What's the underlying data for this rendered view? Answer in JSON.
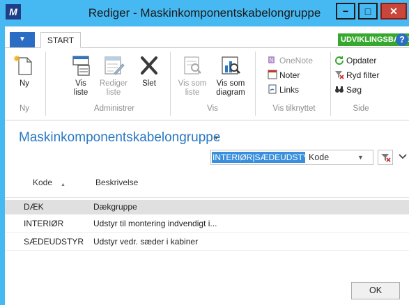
{
  "window": {
    "title": "Rediger - Maskinkomponentskabelongruppe",
    "logo": "M",
    "min": "−",
    "max": "□",
    "close": "✕"
  },
  "ribbon": {
    "menu_glyph": "▼",
    "tab_start": "START",
    "dev_badge": "UDVIKLINGSBASE",
    "help": "?",
    "ny": {
      "label": "Ny",
      "group": "Ny"
    },
    "administrer": {
      "group": "Administrer",
      "vis_liste": [
        "Vis",
        "liste"
      ],
      "rediger_liste": [
        "Rediger",
        "liste"
      ],
      "slet": "Slet"
    },
    "vis": {
      "group": "Vis",
      "vis_som_liste": [
        "Vis som",
        "liste"
      ],
      "vis_som_diagram": [
        "Vis som",
        "diagram"
      ]
    },
    "vis_tilknyttet": {
      "group": "Vis tilknyttet",
      "onenote": "OneNote",
      "noter": "Noter",
      "links": "Links"
    },
    "side": {
      "group": "Side",
      "opdater": "Opdater",
      "ryd_filter": "Ryd filter",
      "sog": "Søg"
    }
  },
  "page": {
    "title": "Maskinkomponentskabelongruppe",
    "title_caret": "▾"
  },
  "filter": {
    "value": "INTERIØR|SÆDEUDSTYR",
    "field": "Kode",
    "dropdown_glyph": "▼",
    "expand_glyph": "⌄"
  },
  "table": {
    "headers": [
      "Kode",
      "Beskrivelse"
    ],
    "sort_glyph": "▲",
    "rows": [
      {
        "kode": "DÆK",
        "beskrivelse": "Dækgruppe"
      },
      {
        "kode": "INTERIØR",
        "beskrivelse": "Udstyr til montering indvendigt i..."
      },
      {
        "kode": "SÆDEUDSTYR",
        "beskrivelse": "Udstyr vedr. sæder i kabiner"
      }
    ]
  },
  "footer": {
    "ok": "OK"
  },
  "colors": {
    "titlebar": "#46b9f2",
    "accent": "#2b78c2",
    "dev_badge": "#37a82e",
    "close": "#c9473a",
    "selection": "#e0e0e0"
  }
}
